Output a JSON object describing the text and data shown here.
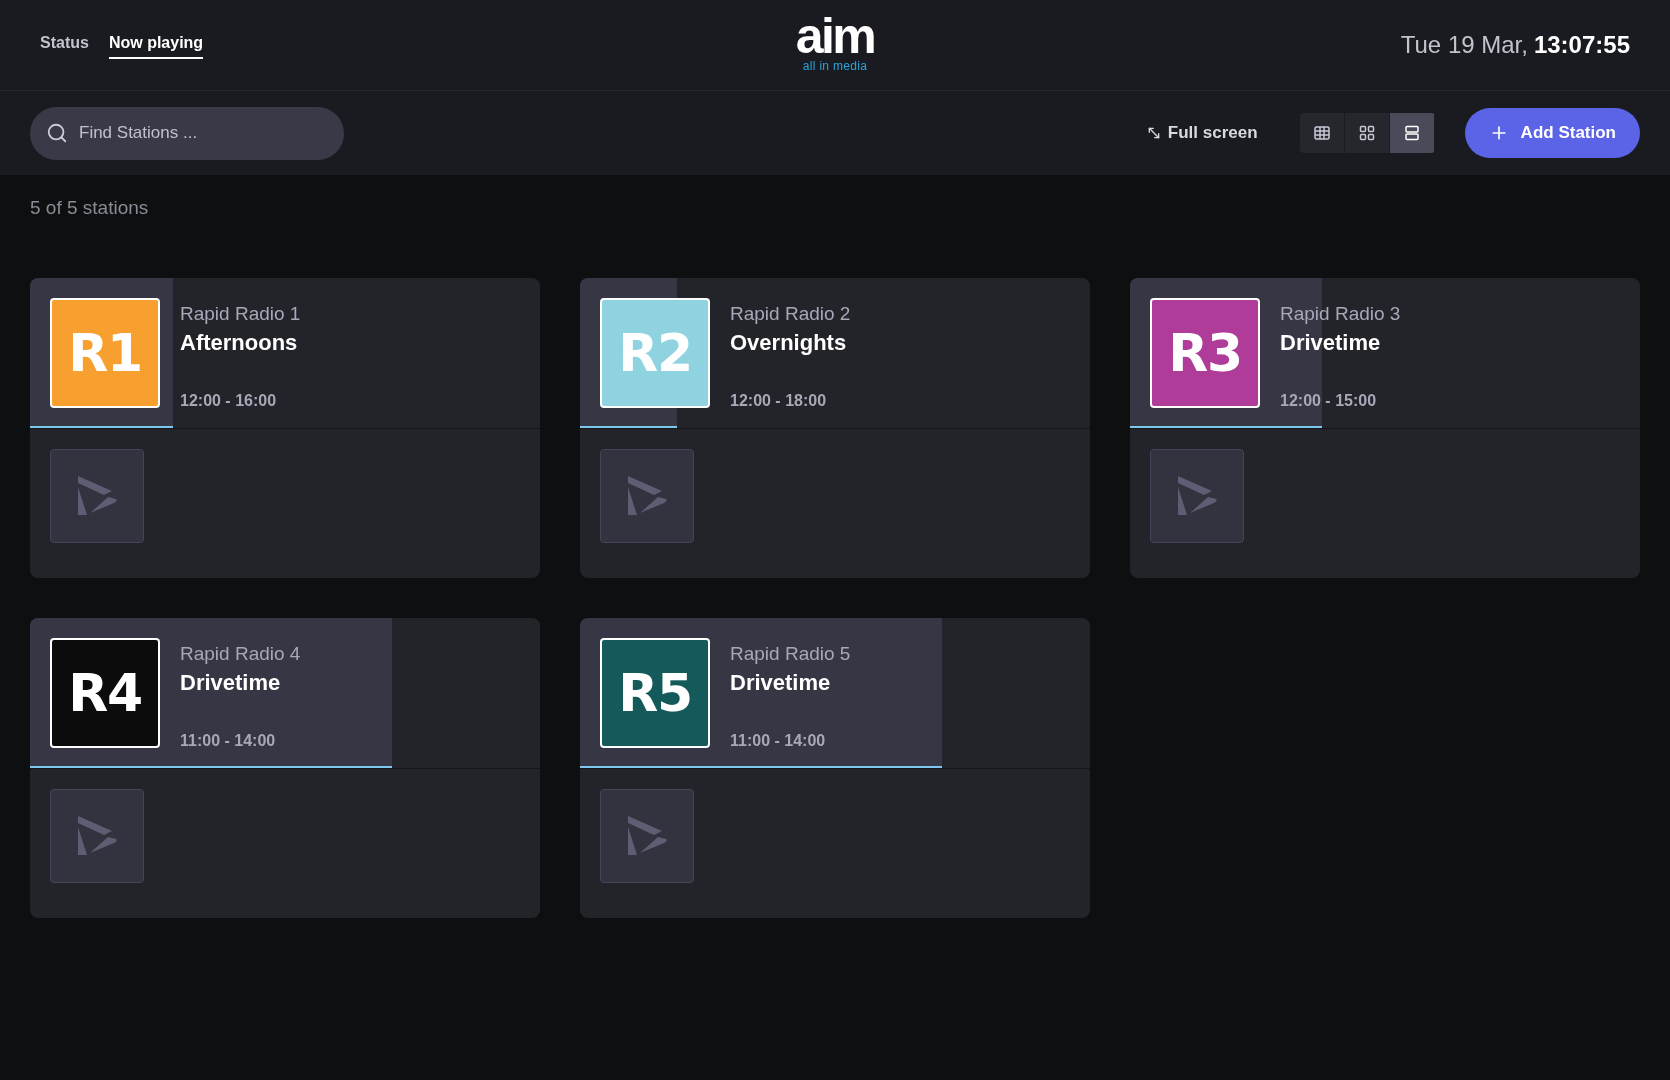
{
  "nav": {
    "tabs": [
      {
        "label": "Status",
        "selected": false
      },
      {
        "label": "Now playing",
        "selected": true
      }
    ]
  },
  "logo": {
    "wordmark": "aim",
    "tagline": "all in media"
  },
  "clock": {
    "date": "Tue 19 Mar,",
    "time": "13:07:55"
  },
  "toolbar": {
    "search": {
      "placeholder": "Find Stations ..."
    },
    "fullscreen": "Full screen",
    "views": [
      {
        "kind": "table",
        "selected": false
      },
      {
        "kind": "grid",
        "selected": false
      },
      {
        "kind": "rows",
        "selected": true
      }
    ],
    "add_button": "Add Station"
  },
  "count": "5 of 5 stations",
  "stations": [
    {
      "badge": "R1",
      "color": "#f7a030",
      "name": "Rapid Radio 1",
      "show": "Afternoons",
      "time": "12:00 - 16:00",
      "level": 0.28
    },
    {
      "badge": "R2",
      "color": "#8fd3e0",
      "name": "Rapid Radio 2",
      "show": "Overnights",
      "time": "12:00 - 18:00",
      "level": 0.19
    },
    {
      "badge": "R3",
      "color": "#b03c9a",
      "name": "Rapid Radio 3",
      "show": "Drivetime",
      "time": "12:00 - 15:00",
      "level": 0.376
    },
    {
      "badge": "R4",
      "color": "#0c0c0c",
      "name": "Rapid Radio 4",
      "show": "Drivetime",
      "time": "11:00 - 14:00",
      "level": 0.71
    },
    {
      "badge": "R5",
      "color": "#145a5a",
      "name": "Rapid Radio 5",
      "show": "Drivetime",
      "time": "11:00 - 14:00",
      "level": 0.71
    }
  ]
}
